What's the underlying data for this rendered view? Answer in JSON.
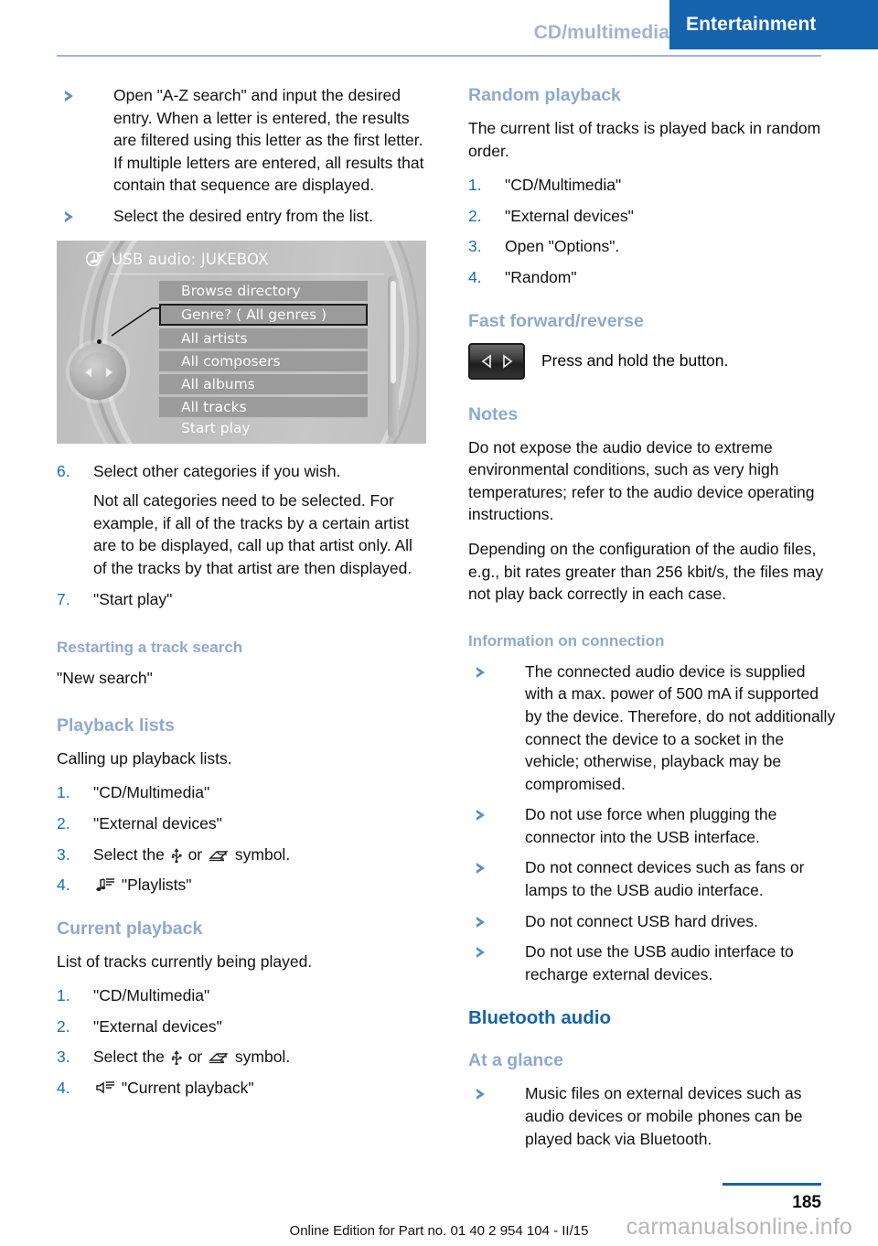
{
  "header": {
    "tab_inactive": "CD/multimedia",
    "tab_active": "Entertainment",
    "accent_color": "#1563ac",
    "muted_blue": "#9fb4d4"
  },
  "left_column": {
    "bullets_top": [
      "Open \"A-Z search\" and input the desired entry. When a letter is entered, the results are filtered using this letter as the first letter. If multiple letters are entered, all results that contain that sequence are displayed.",
      "Select the desired entry from the list."
    ],
    "illustration": {
      "title": "USB audio: JUKEBOX",
      "rows": [
        "Browse directory",
        "Genre? ( All genres )",
        "All artists",
        "All composers",
        "All albums",
        "All tracks",
        "Start play"
      ],
      "selected_row_index": 1
    },
    "steps": [
      {
        "num": "6.",
        "text": "Select other categories if you wish.",
        "sub": "Not all categories need to be selected. For example, if all of the tracks by a certain artist are to be displayed, call up that artist only. All of the tracks by that artist are then displayed."
      },
      {
        "num": "7.",
        "text": "\"Start play\"",
        "sub": ""
      }
    ],
    "restarting": {
      "heading": "Restarting a track search",
      "text": "\"New search\""
    },
    "playback_lists": {
      "heading": "Playback lists",
      "intro": "Calling up playback lists.",
      "steps": [
        {
          "num": "1.",
          "text": "\"CD/Multimedia\""
        },
        {
          "num": "2.",
          "text": "\"External devices\""
        },
        {
          "num": "3.",
          "text_before": "Select the",
          "text_middle": "or",
          "text_after": "symbol."
        },
        {
          "num": "4.",
          "text": "\"Playlists\""
        }
      ]
    },
    "current_playback": {
      "heading": "Current playback",
      "intro": "List of tracks currently being played.",
      "steps": [
        {
          "num": "1.",
          "text": "\"CD/Multimedia\""
        },
        {
          "num": "2.",
          "text": "\"External devices\""
        },
        {
          "num": "3.",
          "text_before": "Select the",
          "text_middle": "or",
          "text_after": "symbol."
        },
        {
          "num": "4.",
          "text": "\"Current playback\""
        }
      ]
    }
  },
  "right_column": {
    "random_playback": {
      "heading": "Random playback",
      "intro": "The current list of tracks is played back in random order.",
      "steps": [
        {
          "num": "1.",
          "text": "\"CD/Multimedia\""
        },
        {
          "num": "2.",
          "text": "\"External devices\""
        },
        {
          "num": "3.",
          "text": "Open \"Options\"."
        },
        {
          "num": "4.",
          "text": "\"Random\""
        }
      ]
    },
    "fast_forward": {
      "heading": "Fast forward/reverse",
      "text": "Press and hold the button."
    },
    "notes": {
      "heading": "Notes",
      "paragraphs": [
        "Do not expose the audio device to extreme environmental conditions, such as very high temperatures; refer to the audio device operating instructions.",
        "Depending on the configuration of the audio files, e.g., bit rates greater than 256 kbit/s, the files may not play back correctly in each case."
      ]
    },
    "information_on_connection": {
      "heading": "Information on connection",
      "bullets": [
        "The connected audio device is supplied with a max. power of 500 mA if supported by the device. Therefore, do not additionally connect the device to a socket in the vehicle; otherwise, playback may be compromised.",
        "Do not use force when plugging the connector into the USB interface.",
        "Do not connect devices such as fans or lamps to the USB audio interface.",
        "Do not connect USB hard drives.",
        "Do not use the USB audio interface to recharge external devices."
      ]
    },
    "bluetooth_audio": {
      "heading": "Bluetooth audio",
      "at_a_glance_heading": "At a glance",
      "bullets": [
        "Music files on external devices such as audio devices or mobile phones can be played back via Bluetooth."
      ]
    }
  },
  "footer": {
    "edition": "Online Edition for Part no. 01 40 2 954 104 - II/15",
    "page_number": "185",
    "watermark": "carmanualsonline.info"
  }
}
